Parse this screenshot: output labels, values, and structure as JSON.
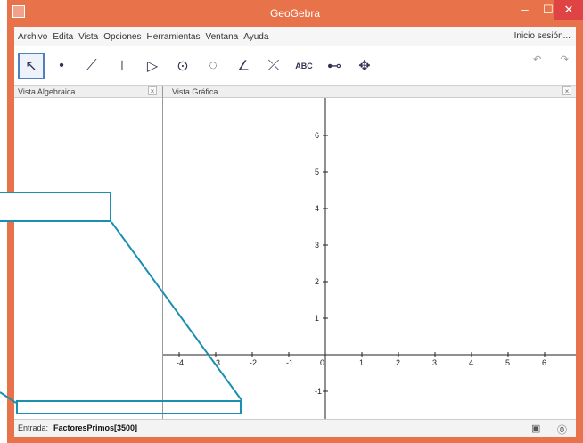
{
  "window": {
    "title": "GeoGebra",
    "min_glyph": "–",
    "max_glyph": "☐",
    "close_glyph": "✕"
  },
  "menu": {
    "items": [
      "Archivo",
      "Edita",
      "Vista",
      "Opciones",
      "Herramientas",
      "Ventana",
      "Ayuda"
    ],
    "login": "Inicio sesión..."
  },
  "toolbar": {
    "tools": [
      {
        "name": "move-tool",
        "glyph": "↖"
      },
      {
        "name": "point-tool",
        "glyph": "•"
      },
      {
        "name": "line-tool",
        "glyph": "⟋"
      },
      {
        "name": "perpendicular-tool",
        "glyph": "⊥"
      },
      {
        "name": "polygon-tool",
        "glyph": "▷"
      },
      {
        "name": "circle-tool",
        "glyph": "⊙"
      },
      {
        "name": "circle-arc-tool",
        "glyph": "◌"
      },
      {
        "name": "angle-tool",
        "glyph": "∠"
      },
      {
        "name": "reflect-tool",
        "glyph": "⤫"
      },
      {
        "name": "text-tool",
        "glyph": "ABC"
      },
      {
        "name": "slider-tool",
        "glyph": "⊷"
      },
      {
        "name": "move-graphics-tool",
        "glyph": "✥"
      }
    ],
    "undo": "↶",
    "redo": "↷"
  },
  "panes": {
    "algebra_title": "Vista Algebraica",
    "graphics_title": "Vista Gráfica",
    "close_glyph": "×"
  },
  "axes": {
    "x_ticks": [
      "-4",
      "-3",
      "-2",
      "-1",
      "0",
      "1",
      "2",
      "3",
      "4",
      "5",
      "6"
    ],
    "y_ticks": [
      "6",
      "5",
      "4",
      "3",
      "2",
      "1",
      "-1",
      "-2"
    ]
  },
  "input_bar": {
    "label": "Entrada:",
    "value": "FactoresPrimos[3500]",
    "icon_a": "▣",
    "icon_b": "⓪"
  },
  "colors": {
    "titlebar": "#e8734a",
    "close": "#e04343",
    "callout": "#1a8fb0"
  }
}
